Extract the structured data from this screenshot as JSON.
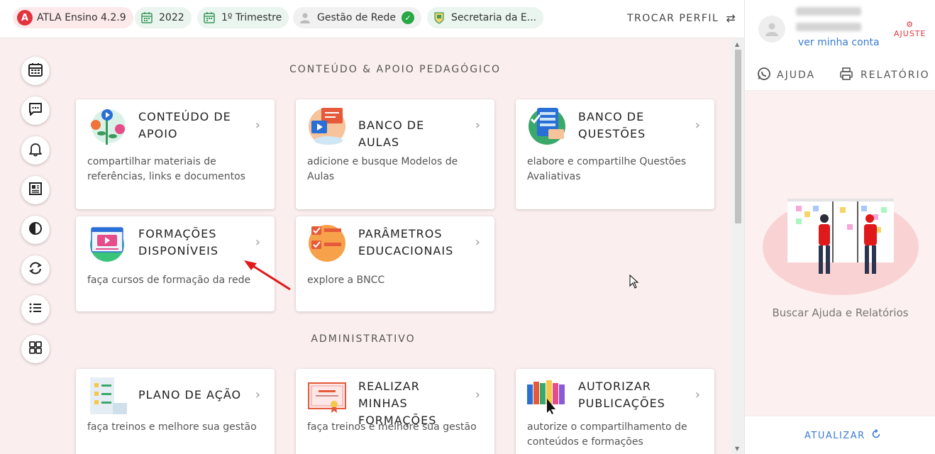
{
  "topbar": {
    "app_name": "ATLA Ensino 4.2.9",
    "year": "2022",
    "period": "1º Trimestre",
    "profile": "Gestão de Rede",
    "secretaria": "Secretaria da E...",
    "trocar_perfil": "TROCAR PERFIL",
    "colors": {
      "brand": "#e2343f",
      "accent": "#3a7bd5",
      "success": "#28a745"
    }
  },
  "rail": {
    "icons": [
      "calendar-icon",
      "chat-icon",
      "bell-icon",
      "newspaper-icon",
      "contrast-icon",
      "sync-icon",
      "list-icon",
      "grid-icon"
    ]
  },
  "sections": {
    "conteudo": {
      "title": "CONTEÚDO & APOIO PEDAGÓGICO",
      "cards": [
        {
          "title": "CONTEÚDO DE APOIO",
          "desc": "compartilhar materiais de referências, links e documentos"
        },
        {
          "title": "BANCO DE AULAS",
          "desc": "adicione e busque Modelos de Aulas"
        },
        {
          "title": "BANCO DE QUESTÕES",
          "desc": "elabore e compartilhe Questões Avaliativas"
        },
        {
          "title": "FORMAÇÕES DISPONÍVEIS",
          "desc": "faça cursos de formação da rede"
        },
        {
          "title": "PARÂMETROS EDUCACIONAIS",
          "desc": "explore a BNCC"
        }
      ]
    },
    "administrativo": {
      "title": "ADMINISTRATIVO",
      "cards": [
        {
          "title": "PLANO DE AÇÃO",
          "desc": "faça treinos e melhore sua gestão"
        },
        {
          "title": "REALIZAR MINHAS FORMAÇÕES",
          "desc": "faça treinos e melhore sua gestão"
        },
        {
          "title": "AUTORIZAR PUBLICAÇÕES",
          "desc": "autorize o compartilhamento de conteúdos e formações"
        }
      ]
    }
  },
  "right_panel": {
    "ver_minha_conta": "ver minha conta",
    "ajuste": "AJUSTE",
    "tab_ajuda": "AJUDA",
    "tab_relatorio": "RELATÓRIO",
    "buscar": "Buscar Ajuda e Relatórios",
    "atualizar": "ATUALIZAR"
  }
}
